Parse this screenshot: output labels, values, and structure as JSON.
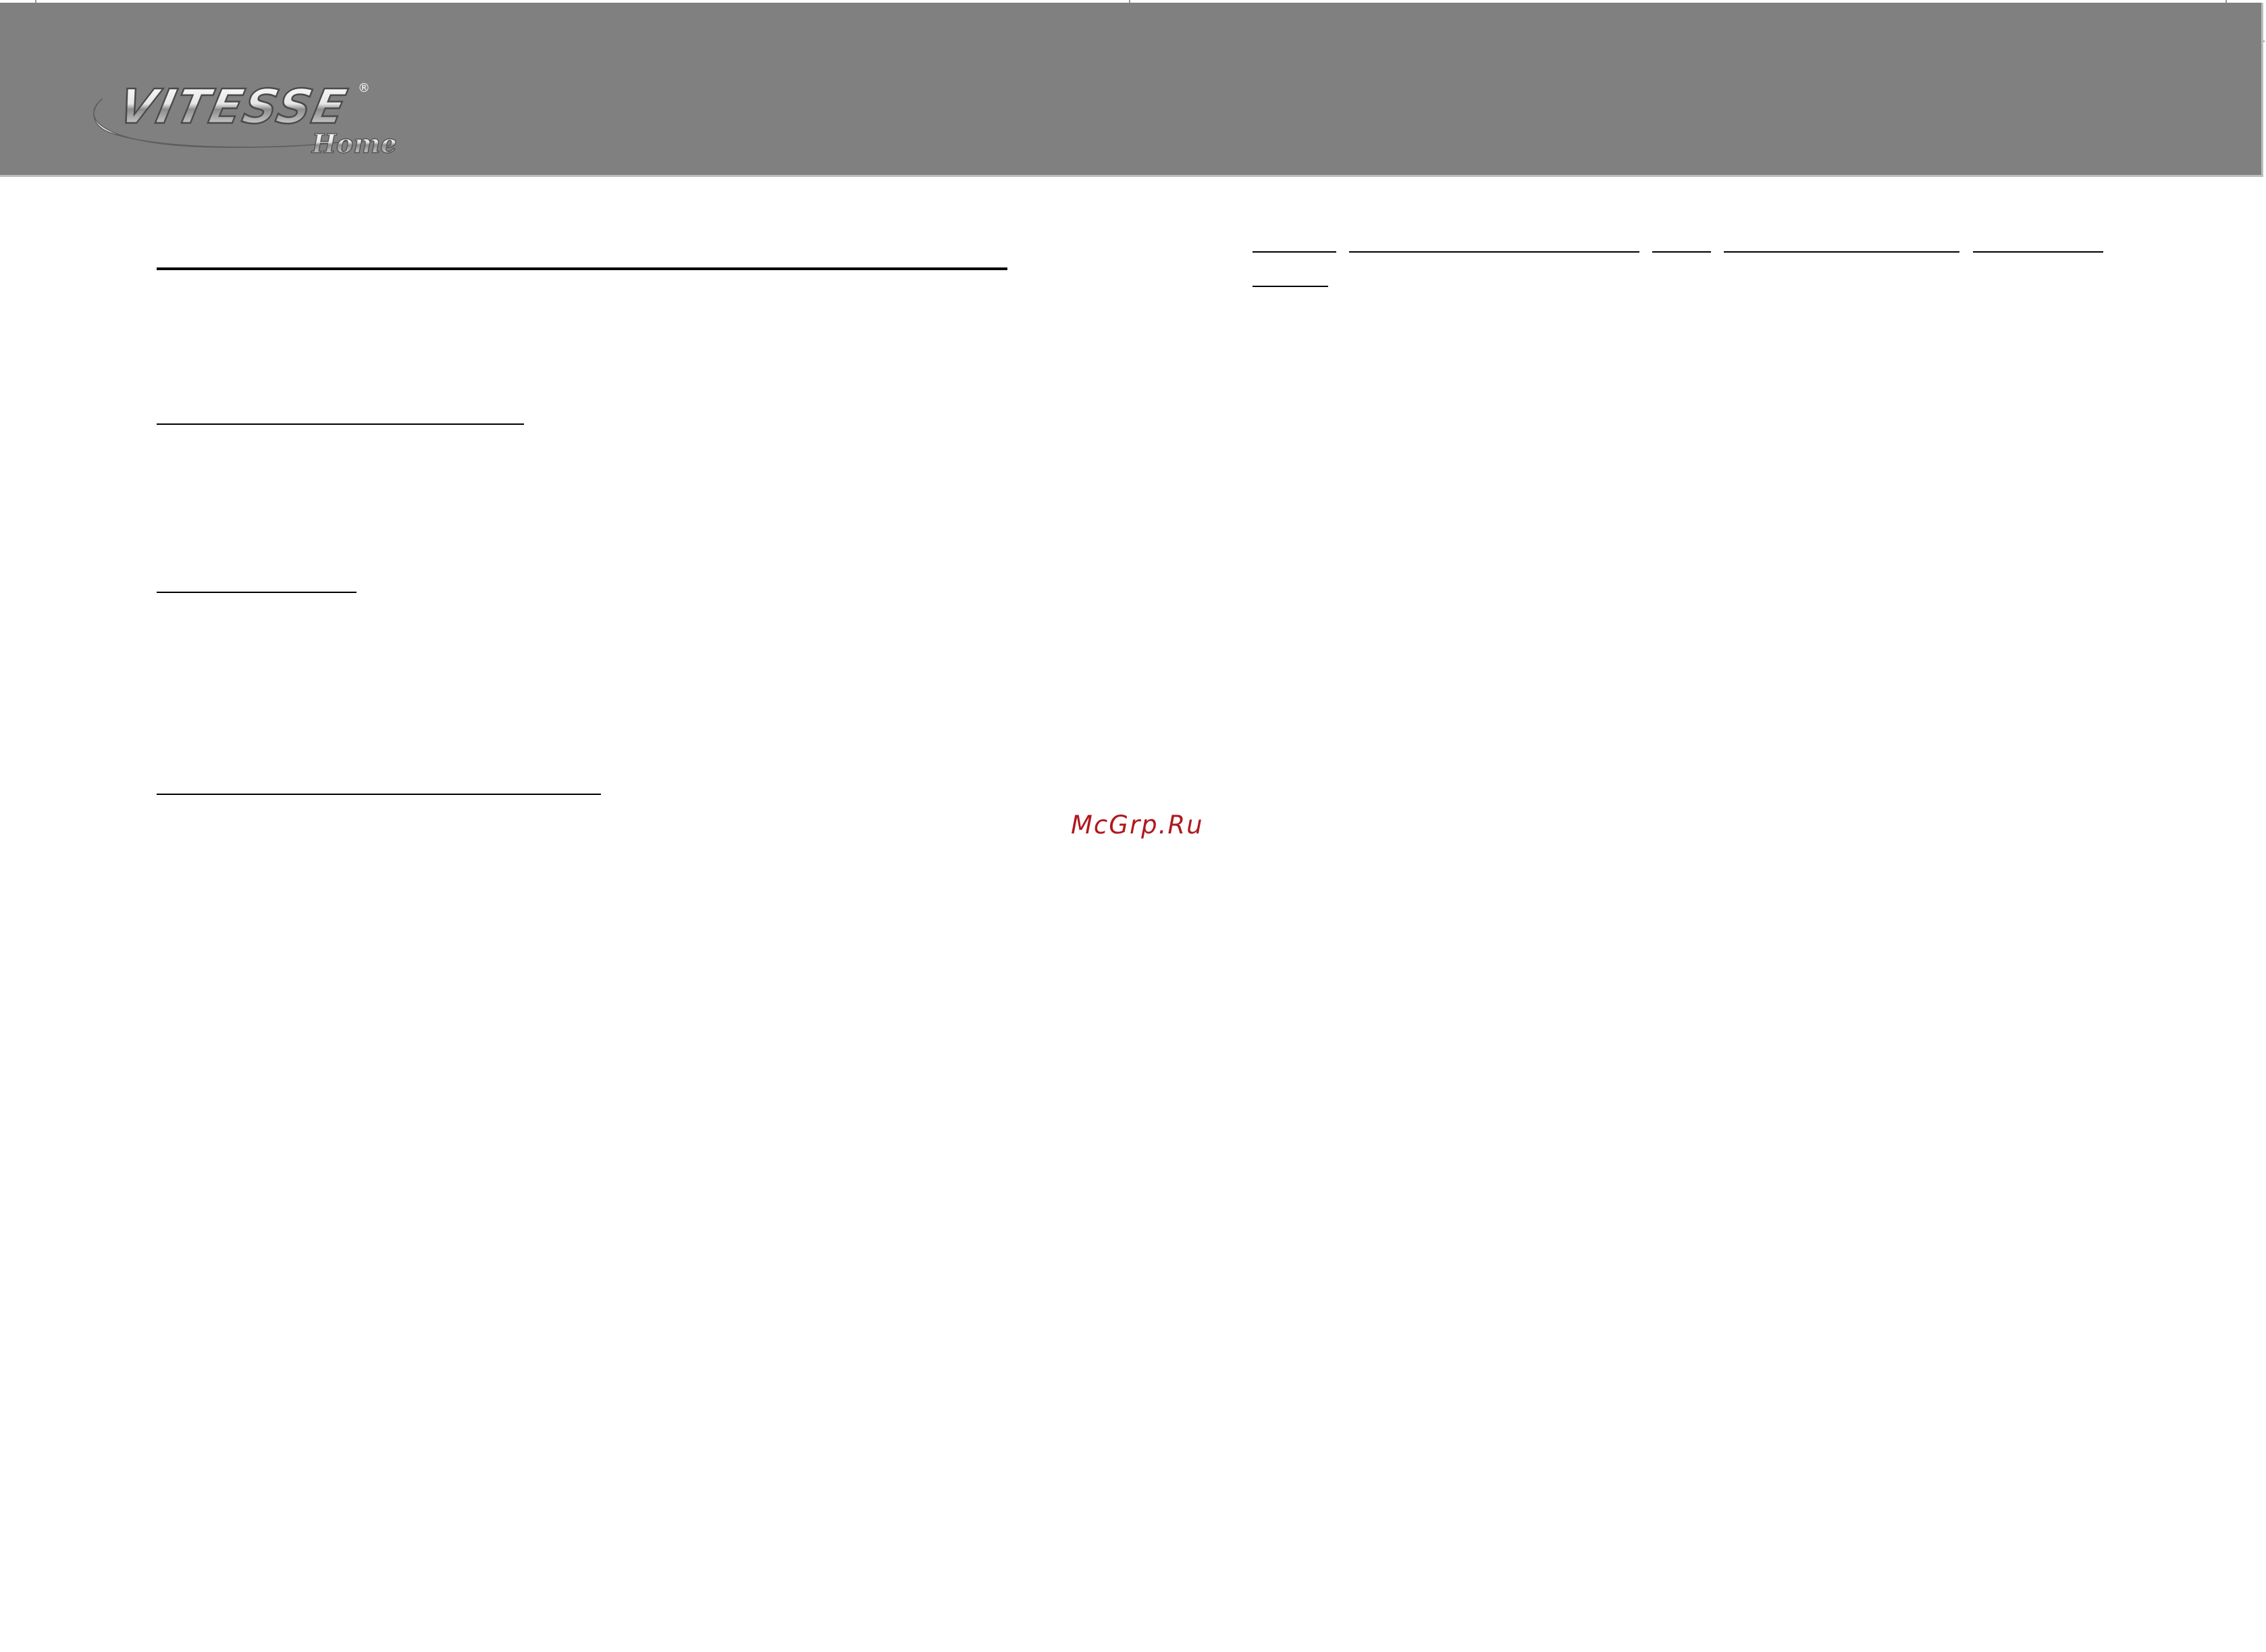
{
  "header": {
    "logo": {
      "brand_text": "VITESSE",
      "sub_text": "Home",
      "mark": "®",
      "icon": "vitesse-home-logo"
    }
  },
  "watermark": {
    "text": "McGrp.Ru"
  },
  "colors": {
    "header_background": "#808080",
    "watermark": "#b0181e",
    "rule": "#000000"
  }
}
